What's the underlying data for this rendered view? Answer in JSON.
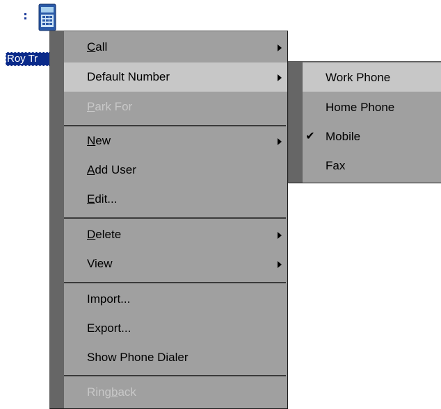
{
  "desktop": {
    "icon_name": "phone-device-icon",
    "label": "Roy Tr"
  },
  "context_menu": {
    "items": [
      {
        "label": "Call",
        "mnemonic": "C",
        "rest": "all",
        "submenu": true,
        "disabled": false
      },
      {
        "label": "Default Number",
        "submenu": true,
        "disabled": false,
        "highlighted": true
      },
      {
        "label": "Park For",
        "mnemonic": "P",
        "rest": "ark For",
        "disabled": true
      },
      {
        "label": "New",
        "mnemonic": "N",
        "rest": "ew",
        "submenu": true
      },
      {
        "label": "Add User",
        "mnemonic": "A",
        "rest": "dd User"
      },
      {
        "label": "Edit...",
        "mnemonic": "E",
        "rest": "dit..."
      },
      {
        "label": "Delete",
        "mnemonic": "D",
        "rest": "elete",
        "submenu": true
      },
      {
        "label": "View",
        "submenu": true
      },
      {
        "label": "Import..."
      },
      {
        "label": "Export..."
      },
      {
        "label": "Show Phone Dialer"
      },
      {
        "label": "Ringback",
        "before": "Ring",
        "mnemonic": "b",
        "rest": "ack",
        "disabled": true
      }
    ]
  },
  "default_number_submenu": {
    "items": [
      {
        "label": "Work Phone",
        "highlighted": true
      },
      {
        "label": "Home Phone"
      },
      {
        "label": "Mobile",
        "checked": true
      },
      {
        "label": "Fax"
      }
    ]
  }
}
